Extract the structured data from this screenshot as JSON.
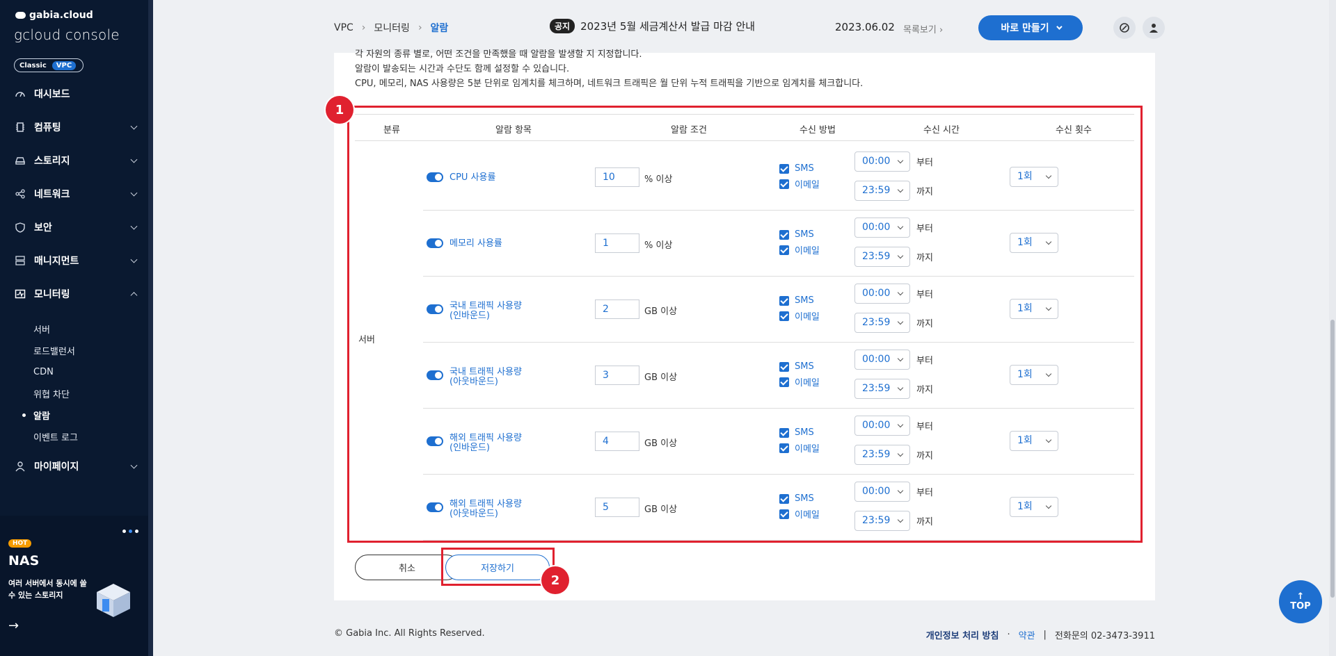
{
  "brand": {
    "top": "gabia.cloud",
    "main": "gcloud console"
  },
  "mode": {
    "classic": "Classic",
    "vpc": "VPC"
  },
  "sidebar": {
    "items": [
      {
        "label": "대시보드",
        "icon": "gauge-icon",
        "expandable": false
      },
      {
        "label": "컴퓨팅",
        "icon": "chip-icon",
        "expandable": true
      },
      {
        "label": "스토리지",
        "icon": "drive-icon",
        "expandable": true
      },
      {
        "label": "네트워크",
        "icon": "network-icon",
        "expandable": true
      },
      {
        "label": "보안",
        "icon": "shield-icon",
        "expandable": true
      },
      {
        "label": "매니지먼트",
        "icon": "server-icon",
        "expandable": true
      },
      {
        "label": "모니터링",
        "icon": "monitor-icon",
        "expandable": true,
        "open": true
      },
      {
        "label": "마이페이지",
        "icon": "user-icon",
        "expandable": true
      }
    ],
    "sub_items": [
      "서버",
      "로드밸런서",
      "CDN",
      "위협 차단",
      "알람",
      "이벤트 로그"
    ],
    "active_sub": "알람"
  },
  "promo": {
    "badge": "HOT",
    "title": "NAS",
    "text": "여러 서버에서 동시에 쓸 수 있는 스토리지",
    "arrow": "→"
  },
  "header": {
    "breadcrumb": [
      "VPC",
      "모니터링",
      "알람"
    ],
    "notice_badge": "공지",
    "notice_text": "2023년 5월 세금계산서 발급 마감 안내",
    "date": "2023.06.02",
    "more": "목록보기",
    "create": "바로 만들기"
  },
  "description": [
    "각 자원의 종류 별로, 어떤 조건을 만족했을 때 알람을 발생할 지 지정합니다.",
    "알람이 발송되는 시간과 수단도 함께 설정할 수 있습니다.",
    "CPU, 메모리, NAS 사용량은 5분 단위로 임계치를 체크하며, 네트워크 트래픽은 월 단위 누적 트래픽을 기반으로 임계치를 체크합니다."
  ],
  "annotations": {
    "marker1": "1",
    "marker2": "2"
  },
  "table": {
    "headers": [
      "분류",
      "알람 항목",
      "알람 조건",
      "수신 방법",
      "수신 시간",
      "수신 횟수"
    ],
    "category": "서버",
    "rows": [
      {
        "label": "CPU 사용률",
        "value": "10",
        "unit": "% 이상"
      },
      {
        "label": "메모리 사용률",
        "value": "1",
        "unit": "% 이상"
      },
      {
        "label": "국내 트래픽 사용량(인바운드)",
        "value": "2",
        "unit": "GB 이상"
      },
      {
        "label": "국내 트래픽 사용량(아웃바운드)",
        "value": "3",
        "unit": "GB 이상"
      },
      {
        "label": "해외 트래픽 사용량(인바운드)",
        "value": "4",
        "unit": "GB 이상"
      },
      {
        "label": "해외 트래픽 사용량(아웃바운드)",
        "value": "5",
        "unit": "GB 이상"
      }
    ],
    "sms": "SMS",
    "email": "이메일",
    "from_time": "00:00",
    "from_label": "부터",
    "to_time": "23:59",
    "to_label": "까지",
    "count": "1회"
  },
  "buttons": {
    "cancel": "취소",
    "save": "저장하기"
  },
  "footer": {
    "copyright": "© Gabia Inc. All Rights Reserved.",
    "privacy": "개인정보 처리 방침",
    "dot": "·",
    "terms": "약관",
    "bar": "|",
    "contact": "전화문의  02-3473-3911"
  },
  "top_button": {
    "arrow": "↑",
    "label": "TOP"
  }
}
